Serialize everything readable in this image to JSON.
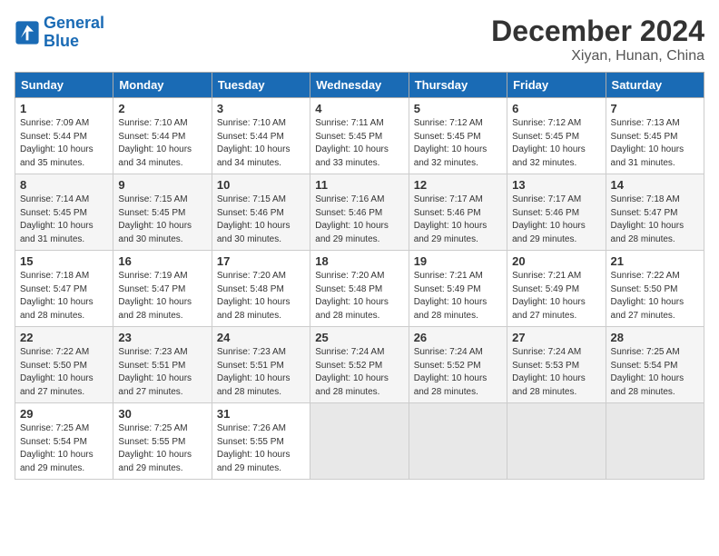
{
  "header": {
    "logo_line1": "General",
    "logo_line2": "Blue",
    "title": "December 2024",
    "subtitle": "Xiyan, Hunan, China"
  },
  "weekdays": [
    "Sunday",
    "Monday",
    "Tuesday",
    "Wednesday",
    "Thursday",
    "Friday",
    "Saturday"
  ],
  "weeks": [
    [
      {
        "day": "1",
        "info": "Sunrise: 7:09 AM\nSunset: 5:44 PM\nDaylight: 10 hours\nand 35 minutes."
      },
      {
        "day": "2",
        "info": "Sunrise: 7:10 AM\nSunset: 5:44 PM\nDaylight: 10 hours\nand 34 minutes."
      },
      {
        "day": "3",
        "info": "Sunrise: 7:10 AM\nSunset: 5:44 PM\nDaylight: 10 hours\nand 34 minutes."
      },
      {
        "day": "4",
        "info": "Sunrise: 7:11 AM\nSunset: 5:45 PM\nDaylight: 10 hours\nand 33 minutes."
      },
      {
        "day": "5",
        "info": "Sunrise: 7:12 AM\nSunset: 5:45 PM\nDaylight: 10 hours\nand 32 minutes."
      },
      {
        "day": "6",
        "info": "Sunrise: 7:12 AM\nSunset: 5:45 PM\nDaylight: 10 hours\nand 32 minutes."
      },
      {
        "day": "7",
        "info": "Sunrise: 7:13 AM\nSunset: 5:45 PM\nDaylight: 10 hours\nand 31 minutes."
      }
    ],
    [
      {
        "day": "8",
        "info": "Sunrise: 7:14 AM\nSunset: 5:45 PM\nDaylight: 10 hours\nand 31 minutes."
      },
      {
        "day": "9",
        "info": "Sunrise: 7:15 AM\nSunset: 5:45 PM\nDaylight: 10 hours\nand 30 minutes."
      },
      {
        "day": "10",
        "info": "Sunrise: 7:15 AM\nSunset: 5:46 PM\nDaylight: 10 hours\nand 30 minutes."
      },
      {
        "day": "11",
        "info": "Sunrise: 7:16 AM\nSunset: 5:46 PM\nDaylight: 10 hours\nand 29 minutes."
      },
      {
        "day": "12",
        "info": "Sunrise: 7:17 AM\nSunset: 5:46 PM\nDaylight: 10 hours\nand 29 minutes."
      },
      {
        "day": "13",
        "info": "Sunrise: 7:17 AM\nSunset: 5:46 PM\nDaylight: 10 hours\nand 29 minutes."
      },
      {
        "day": "14",
        "info": "Sunrise: 7:18 AM\nSunset: 5:47 PM\nDaylight: 10 hours\nand 28 minutes."
      }
    ],
    [
      {
        "day": "15",
        "info": "Sunrise: 7:18 AM\nSunset: 5:47 PM\nDaylight: 10 hours\nand 28 minutes."
      },
      {
        "day": "16",
        "info": "Sunrise: 7:19 AM\nSunset: 5:47 PM\nDaylight: 10 hours\nand 28 minutes."
      },
      {
        "day": "17",
        "info": "Sunrise: 7:20 AM\nSunset: 5:48 PM\nDaylight: 10 hours\nand 28 minutes."
      },
      {
        "day": "18",
        "info": "Sunrise: 7:20 AM\nSunset: 5:48 PM\nDaylight: 10 hours\nand 28 minutes."
      },
      {
        "day": "19",
        "info": "Sunrise: 7:21 AM\nSunset: 5:49 PM\nDaylight: 10 hours\nand 28 minutes."
      },
      {
        "day": "20",
        "info": "Sunrise: 7:21 AM\nSunset: 5:49 PM\nDaylight: 10 hours\nand 27 minutes."
      },
      {
        "day": "21",
        "info": "Sunrise: 7:22 AM\nSunset: 5:50 PM\nDaylight: 10 hours\nand 27 minutes."
      }
    ],
    [
      {
        "day": "22",
        "info": "Sunrise: 7:22 AM\nSunset: 5:50 PM\nDaylight: 10 hours\nand 27 minutes."
      },
      {
        "day": "23",
        "info": "Sunrise: 7:23 AM\nSunset: 5:51 PM\nDaylight: 10 hours\nand 27 minutes."
      },
      {
        "day": "24",
        "info": "Sunrise: 7:23 AM\nSunset: 5:51 PM\nDaylight: 10 hours\nand 28 minutes."
      },
      {
        "day": "25",
        "info": "Sunrise: 7:24 AM\nSunset: 5:52 PM\nDaylight: 10 hours\nand 28 minutes."
      },
      {
        "day": "26",
        "info": "Sunrise: 7:24 AM\nSunset: 5:52 PM\nDaylight: 10 hours\nand 28 minutes."
      },
      {
        "day": "27",
        "info": "Sunrise: 7:24 AM\nSunset: 5:53 PM\nDaylight: 10 hours\nand 28 minutes."
      },
      {
        "day": "28",
        "info": "Sunrise: 7:25 AM\nSunset: 5:54 PM\nDaylight: 10 hours\nand 28 minutes."
      }
    ],
    [
      {
        "day": "29",
        "info": "Sunrise: 7:25 AM\nSunset: 5:54 PM\nDaylight: 10 hours\nand 29 minutes."
      },
      {
        "day": "30",
        "info": "Sunrise: 7:25 AM\nSunset: 5:55 PM\nDaylight: 10 hours\nand 29 minutes."
      },
      {
        "day": "31",
        "info": "Sunrise: 7:26 AM\nSunset: 5:55 PM\nDaylight: 10 hours\nand 29 minutes."
      },
      null,
      null,
      null,
      null
    ]
  ]
}
